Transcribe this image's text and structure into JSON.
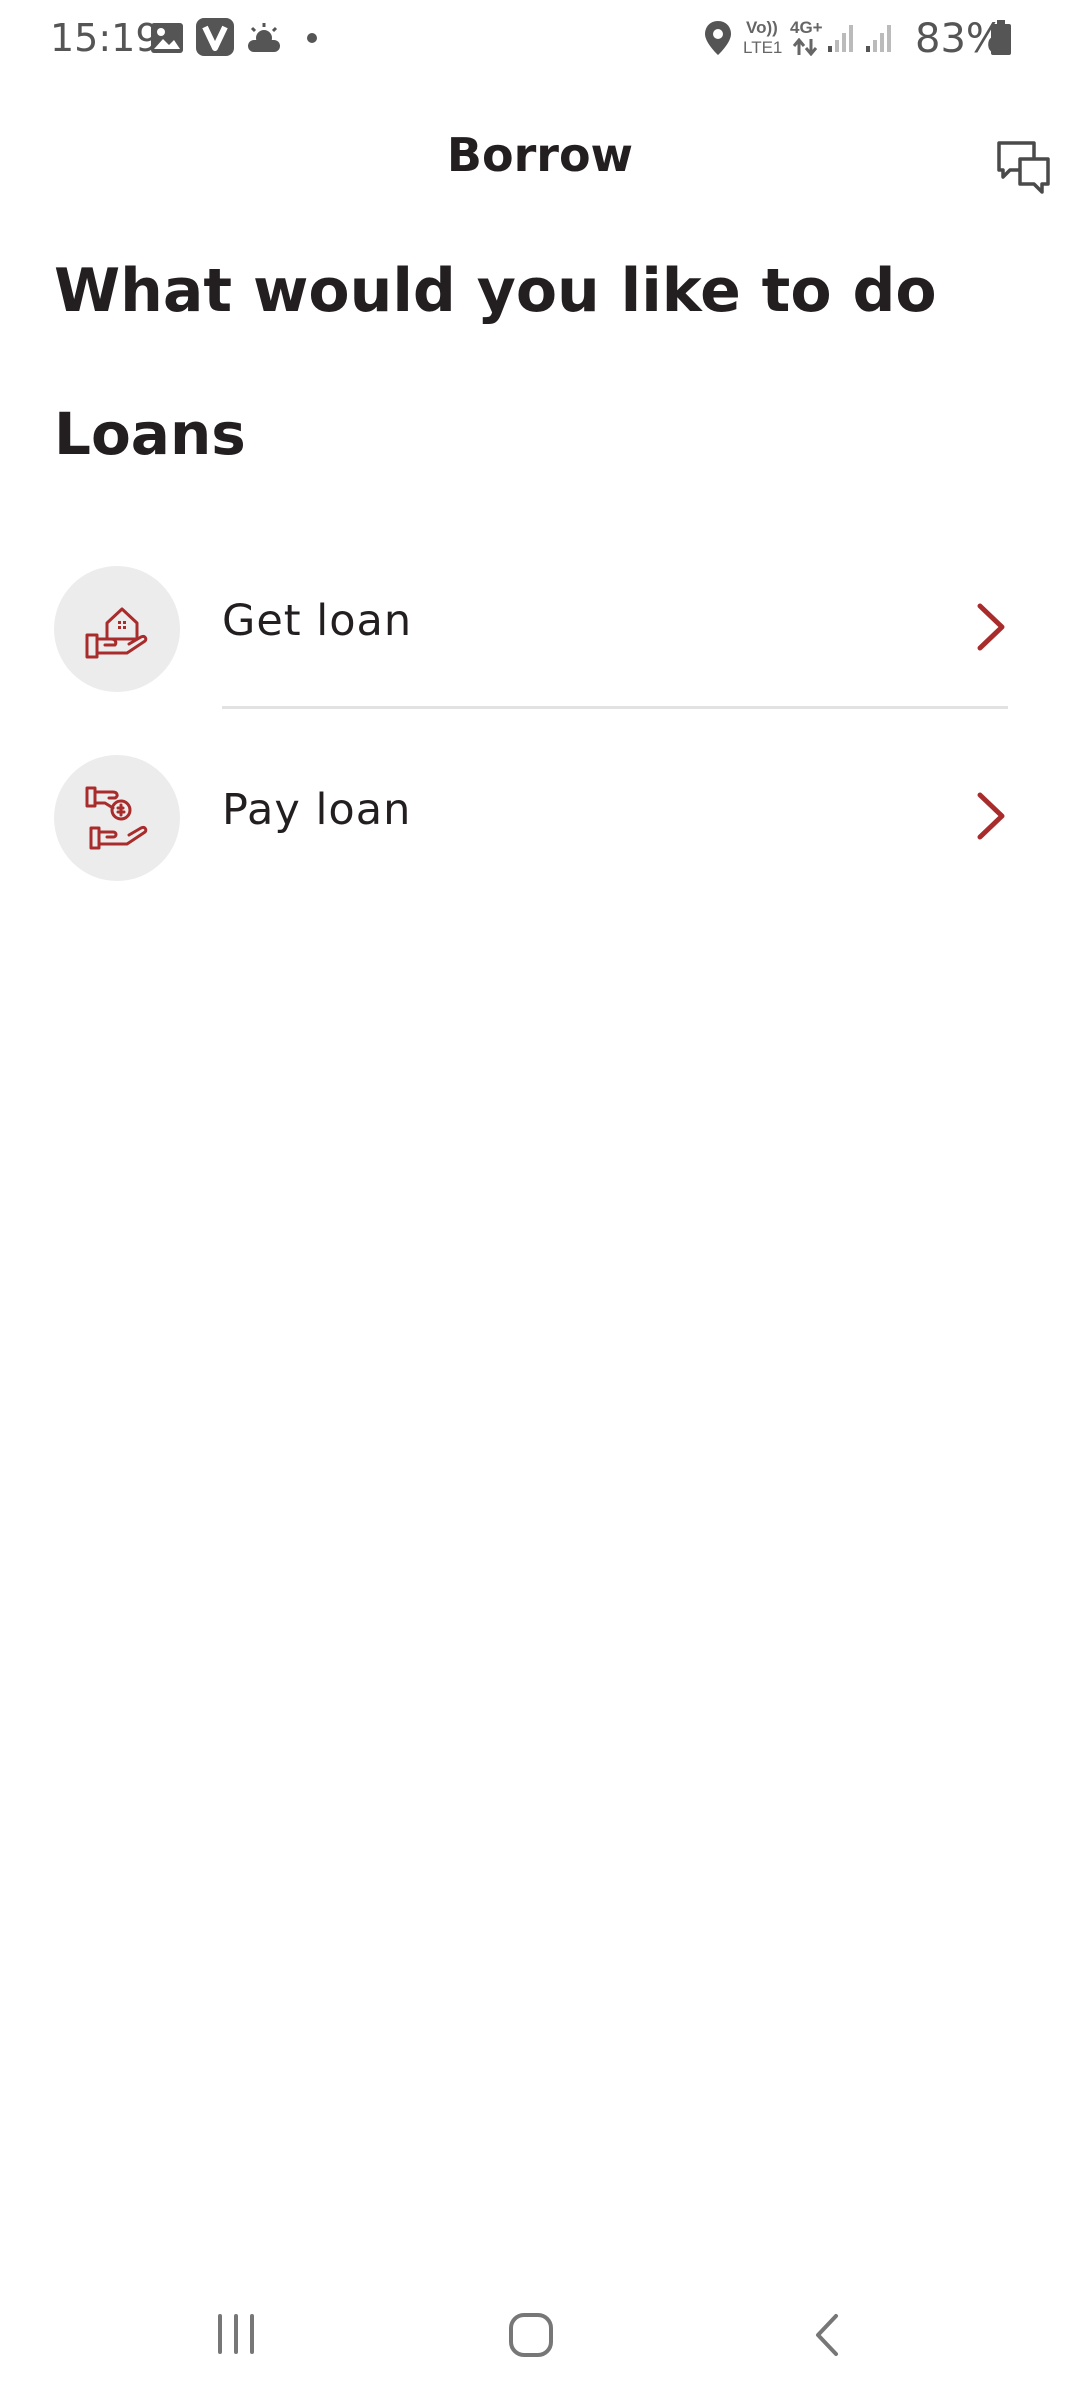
{
  "status_bar": {
    "time": "15:19",
    "network_top": "Vo))",
    "network_bottom": "LTE1",
    "network_type": "4G+",
    "battery": "83%",
    "icons": [
      "image-icon",
      "v-app-icon",
      "weather-icon",
      "dot-icon",
      "location-icon",
      "signal-icon",
      "battery-icon"
    ]
  },
  "header": {
    "title": "Borrow",
    "chat_icon": "chat-bubbles-icon"
  },
  "main": {
    "heading": "What would you like to do",
    "section_title": "Loans",
    "items": [
      {
        "label": "Get loan",
        "icon": "hand-house-icon"
      },
      {
        "label": "Pay loan",
        "icon": "hand-coin-icon"
      }
    ]
  },
  "nav_bar": {
    "buttons": [
      "recent-apps-icon",
      "home-icon",
      "back-icon"
    ]
  },
  "colors": {
    "accent": "#a82c2c",
    "text": "#231f20",
    "icon_bg": "#ececec",
    "divider": "#e2e2e2"
  }
}
